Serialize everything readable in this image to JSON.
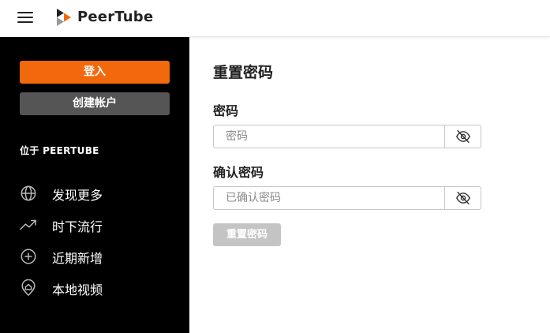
{
  "header": {
    "brand_name": "PeerTube",
    "menu_icon": "hamburger-menu-icon",
    "logo_icon": "peertube-logo-icon"
  },
  "sidebar": {
    "login_label": "登入",
    "create_account_label": "创建帐户",
    "section_title": "位于 PEERTUBE",
    "items": [
      {
        "label": "发现更多",
        "icon": "globe-icon"
      },
      {
        "label": "时下流行",
        "icon": "trending-icon"
      },
      {
        "label": "近期新增",
        "icon": "plus-circle-icon"
      },
      {
        "label": "本地视频",
        "icon": "home-pin-icon"
      }
    ]
  },
  "main": {
    "title": "重置密码",
    "password": {
      "label": "密码",
      "placeholder": "密码",
      "value": "",
      "toggle_icon": "eye-off-icon"
    },
    "confirm_password": {
      "label": "确认密码",
      "placeholder": "已确认密码",
      "value": "",
      "toggle_icon": "eye-off-icon"
    },
    "submit_label": "重置密码"
  },
  "colors": {
    "accent": "#f2690d",
    "sidebar_bg": "#000000",
    "secondary_button": "#555555",
    "disabled_button": "#c4c4c4"
  }
}
